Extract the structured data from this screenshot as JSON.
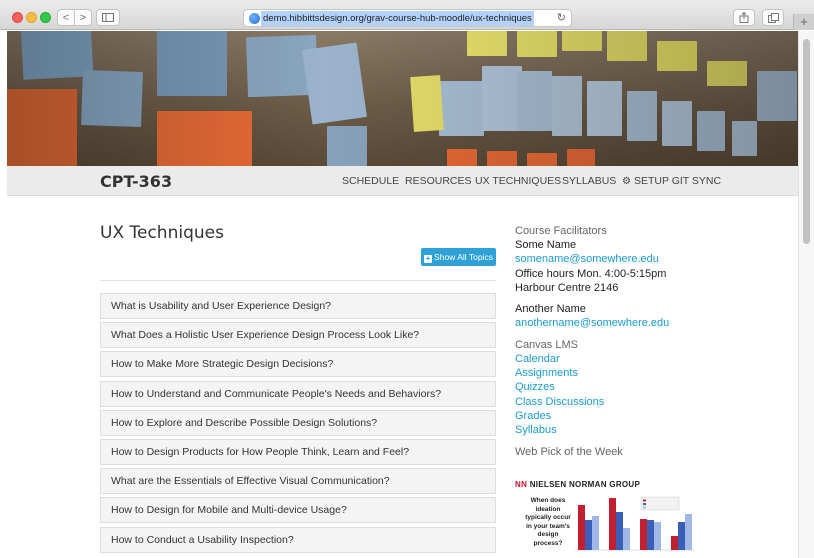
{
  "browser": {
    "url": "demo.hibbittsdesign.org/grav-course-hub-moodle/ux-techniques",
    "back_icon": "<",
    "forward_icon": ">",
    "reload_icon": "↻",
    "new_tab": "+"
  },
  "site": {
    "title": "CPT-363",
    "nav": [
      "SCHEDULE",
      "RESOURCES",
      "UX TECHNIQUES",
      "SYLLABUS",
      "SETUP GIT SYNC"
    ]
  },
  "main": {
    "title": "UX Techniques",
    "show_all_label": "Show All Topics",
    "topics": [
      "What is Usability and User Experience Design?",
      "What Does a Holistic User Experience Design Process Look Like?",
      "How to Make More Strategic Design Decisions?",
      "How to Understand and Communicate People's Needs and Behaviors?",
      "How to Explore and Describe Possible Design Solutions?",
      "How to Design Products for How People Think, Learn and Feel?",
      "What are the Essentials of Effective Visual Communication?",
      "How to Design for Mobile and Multi-device Usage?",
      "How to Conduct a Usability Inspection?"
    ]
  },
  "sidebar": {
    "facilitators_heading": "Course Facilitators",
    "facilitator1_name": "Some Name",
    "facilitator1_email": "somename@somewhere.edu",
    "facilitator1_hours": "Office hours Mon. 4:00-5:15pm",
    "facilitator1_office": "Harbour Centre 2146",
    "facilitator2_name": "Another Name",
    "facilitator2_email": "anothername@somewhere.edu",
    "lms_heading": "Canvas LMS",
    "lms_links": [
      "Calendar",
      "Assignments",
      "Quizzes",
      "Class Discussions",
      "Grades",
      "Syllabus"
    ],
    "web_pick_heading": "Web Pick of the Week",
    "web_pick_logo_mark": "NN",
    "web_pick_logo_text": "NIELSEN NORMAN GROUP",
    "web_pick_question": "When does ideation typically occur in your team's design process?"
  },
  "colors": {
    "accent": "#2ea1d6",
    "link": "#1a9ad1",
    "nng_red": "#c8102e",
    "chart_red": "#c0202f",
    "chart_blue": "#3b5fb8",
    "chart_lightblue": "#9fb8e6"
  }
}
